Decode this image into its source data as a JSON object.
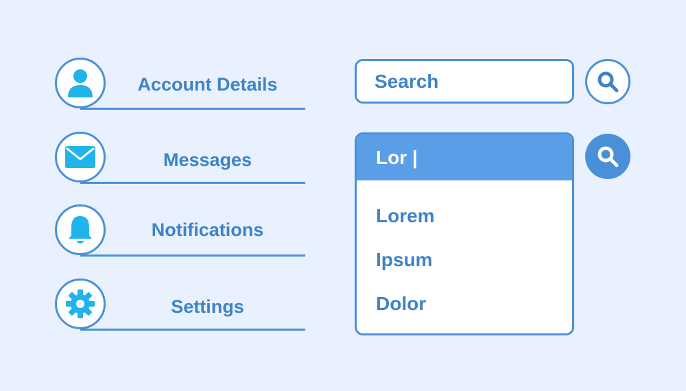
{
  "menu": {
    "items": [
      {
        "label": "Account Details",
        "icon": "user-icon"
      },
      {
        "label": "Messages",
        "icon": "envelope-icon"
      },
      {
        "label": "Notifications",
        "icon": "bell-icon"
      },
      {
        "label": "Settings",
        "icon": "gear-icon"
      }
    ]
  },
  "search": {
    "placeholder": "Search",
    "button_icon": "search-icon"
  },
  "autocomplete": {
    "input_value": "Lor |",
    "options": [
      "Lorem",
      "Ipsum",
      "Dolor"
    ],
    "button_icon": "search-icon"
  },
  "colors": {
    "background": "#e8f1fd",
    "outline": "#4a90d9",
    "text": "#3f83c7",
    "icon": "#21b4ec",
    "header_fill": "#5b9ee8"
  }
}
